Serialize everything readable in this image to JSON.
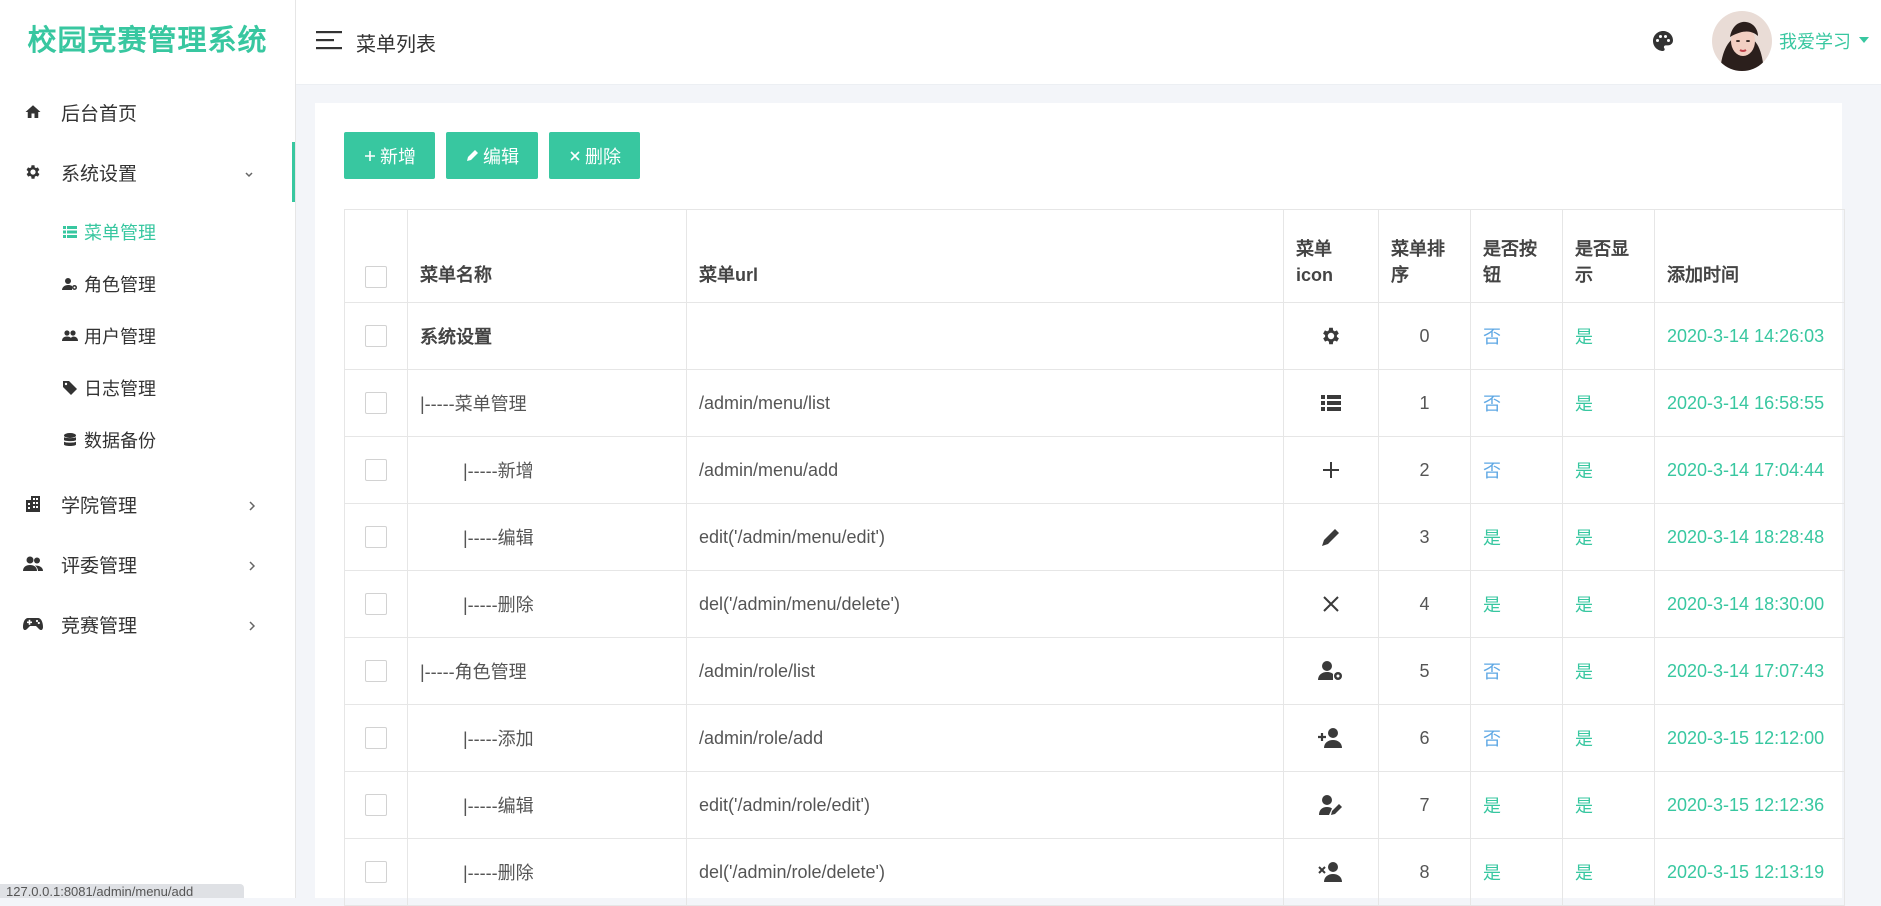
{
  "app": {
    "logo": "校园竞赛管理系统",
    "page_title": "菜单列表",
    "username": "我爱学习"
  },
  "sidebar": {
    "items": [
      {
        "label": "后台首页",
        "icon": "home-icon"
      },
      {
        "label": "系统设置",
        "icon": "gear-icon",
        "expanded": true
      },
      {
        "label": "学院管理",
        "icon": "building-icon"
      },
      {
        "label": "评委管理",
        "icon": "users-icon"
      },
      {
        "label": "竞赛管理",
        "icon": "gamepad-icon"
      }
    ],
    "sub_items": [
      {
        "label": "菜单管理",
        "icon": "list-icon",
        "active": true
      },
      {
        "label": "角色管理",
        "icon": "user-cog-icon"
      },
      {
        "label": "用户管理",
        "icon": "users-icon"
      },
      {
        "label": "日志管理",
        "icon": "tag-icon"
      },
      {
        "label": "数据备份",
        "icon": "database-icon"
      }
    ]
  },
  "toolbar": {
    "add_label": "新增",
    "edit_label": "编辑",
    "delete_label": "删除"
  },
  "table": {
    "headers": {
      "name": "菜单名称",
      "url": "菜单url",
      "icon": "菜单icon",
      "sort": "菜单排序",
      "is_button": "是否按钮",
      "is_show": "是否显示",
      "time": "添加时间"
    },
    "rows": [
      {
        "name": "系统设置",
        "url": "",
        "icon": "gear-icon",
        "sort": "0",
        "is_button": "否",
        "is_show": "是",
        "time": "2020-3-14 14:26:03"
      },
      {
        "name": "|-----菜单管理",
        "url": "/admin/menu/list",
        "icon": "list-icon",
        "sort": "1",
        "is_button": "否",
        "is_show": "是",
        "time": "2020-3-14 16:58:55"
      },
      {
        "name": "|-----新增",
        "url": "/admin/menu/add",
        "icon": "plus-icon",
        "sort": "2",
        "is_button": "否",
        "is_show": "是",
        "time": "2020-3-14 17:04:44"
      },
      {
        "name": "|-----编辑",
        "url": "edit('/admin/menu/edit')",
        "icon": "pencil-icon",
        "sort": "3",
        "is_button": "是",
        "is_show": "是",
        "time": "2020-3-14 18:28:48"
      },
      {
        "name": "|-----删除",
        "url": "del('/admin/menu/delete')",
        "icon": "close-icon",
        "sort": "4",
        "is_button": "是",
        "is_show": "是",
        "time": "2020-3-14 18:30:00"
      },
      {
        "name": "|-----角色管理",
        "url": "/admin/role/list",
        "icon": "user-cog-icon",
        "sort": "5",
        "is_button": "否",
        "is_show": "是",
        "time": "2020-3-14 17:07:43"
      },
      {
        "name": "|-----添加",
        "url": "/admin/role/add",
        "icon": "user-plus-icon",
        "sort": "6",
        "is_button": "否",
        "is_show": "是",
        "time": "2020-3-15 12:12:00"
      },
      {
        "name": "|-----编辑",
        "url": "edit('/admin/role/edit')",
        "icon": "user-edit-icon",
        "sort": "7",
        "is_button": "是",
        "is_show": "是",
        "time": "2020-3-15 12:12:36"
      },
      {
        "name": "|-----删除",
        "url": "del('/admin/role/delete')",
        "icon": "user-times-icon",
        "sort": "8",
        "is_button": "是",
        "is_show": "是",
        "time": "2020-3-15 12:13:19"
      }
    ]
  },
  "status_bar": {
    "url": "127.0.0.1:8081/admin/menu/add"
  },
  "colors": {
    "accent": "#38c7a0",
    "no": "#5fa8e4"
  }
}
